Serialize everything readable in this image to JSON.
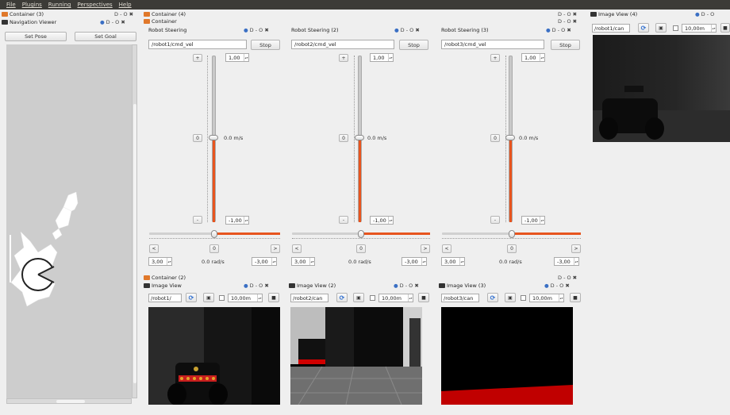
{
  "menu": [
    "File",
    "Plugins",
    "Running",
    "Perspectives",
    "Help"
  ],
  "left_panel": {
    "container_title": "Container (3)",
    "container_ctrls": "D  - O ✖",
    "nav_title": "Navigation Viewer",
    "nav_ctrls": "D  - O ✖",
    "set_pose": "Set Pose",
    "set_goal": "Set Goal"
  },
  "top_container": {
    "title": "Container (4)",
    "ctrls": "D  - O ✖",
    "inner_title": "Container",
    "inner_ctrls": "D  - O ✖"
  },
  "steering": [
    {
      "title": "Robot Steering",
      "topic": "/robot1/cmd_vel",
      "stop": "Stop",
      "plus": "+",
      "zero_btn": "0",
      "minus": "-",
      "max_lin": "1,00",
      "lin_value": "0.0 m/s",
      "min_lin": "-1,00",
      "left": "<",
      "zero_ang": "0",
      "right": ">",
      "max_ang": "3,00",
      "ang_value": "0.0 rad/s",
      "min_ang": "-3,00",
      "ctrls": "D  - O ✖"
    },
    {
      "title": "Robot Steering (2)",
      "topic": "/robot2/cmd_vel",
      "stop": "Stop",
      "plus": "+",
      "zero_btn": "0",
      "minus": "-",
      "max_lin": "1,00",
      "lin_value": "0.0 m/s",
      "min_lin": "-1,00",
      "left": "<",
      "zero_ang": "0",
      "right": ">",
      "max_ang": "3,00",
      "ang_value": "0.0 rad/s",
      "min_ang": "-3,00",
      "ctrls": "D  - O ✖"
    },
    {
      "title": "Robot Steering (3)",
      "topic": "/robot3/cmd_vel",
      "stop": "Stop",
      "plus": "+",
      "zero_btn": "0",
      "minus": "-",
      "max_lin": "1,00",
      "lin_value": "0.0 m/s",
      "min_lin": "-1,00",
      "left": "<",
      "zero_ang": "0",
      "right": ">",
      "max_ang": "3,00",
      "ang_value": "0.0 rad/s",
      "min_ang": "-3,00",
      "ctrls": "D  - O ✖"
    }
  ],
  "image_view_4": {
    "title": "Image View (4)",
    "ctrls": "D  - O",
    "topic": "/robot1/can",
    "zoom": "10,00m"
  },
  "bottom_container": {
    "title": "Container (2)",
    "ctrls": "D  - O ✖"
  },
  "image_views": [
    {
      "title": "Image View",
      "ctrls": "D  - O ✖",
      "topic": "/robot1/",
      "zoom": "10,00m"
    },
    {
      "title": "Image View (2)",
      "ctrls": "D  - O ✖",
      "topic": "/robot2/can",
      "zoom": "10,00m"
    },
    {
      "title": "Image View (3)",
      "ctrls": "D  - O ✖",
      "topic": "/robot3/can",
      "zoom": "10,00m"
    }
  ],
  "colors": {
    "accent": "#e7541e",
    "menubar": "#3c3b37",
    "panel_bg": "#efefef"
  }
}
